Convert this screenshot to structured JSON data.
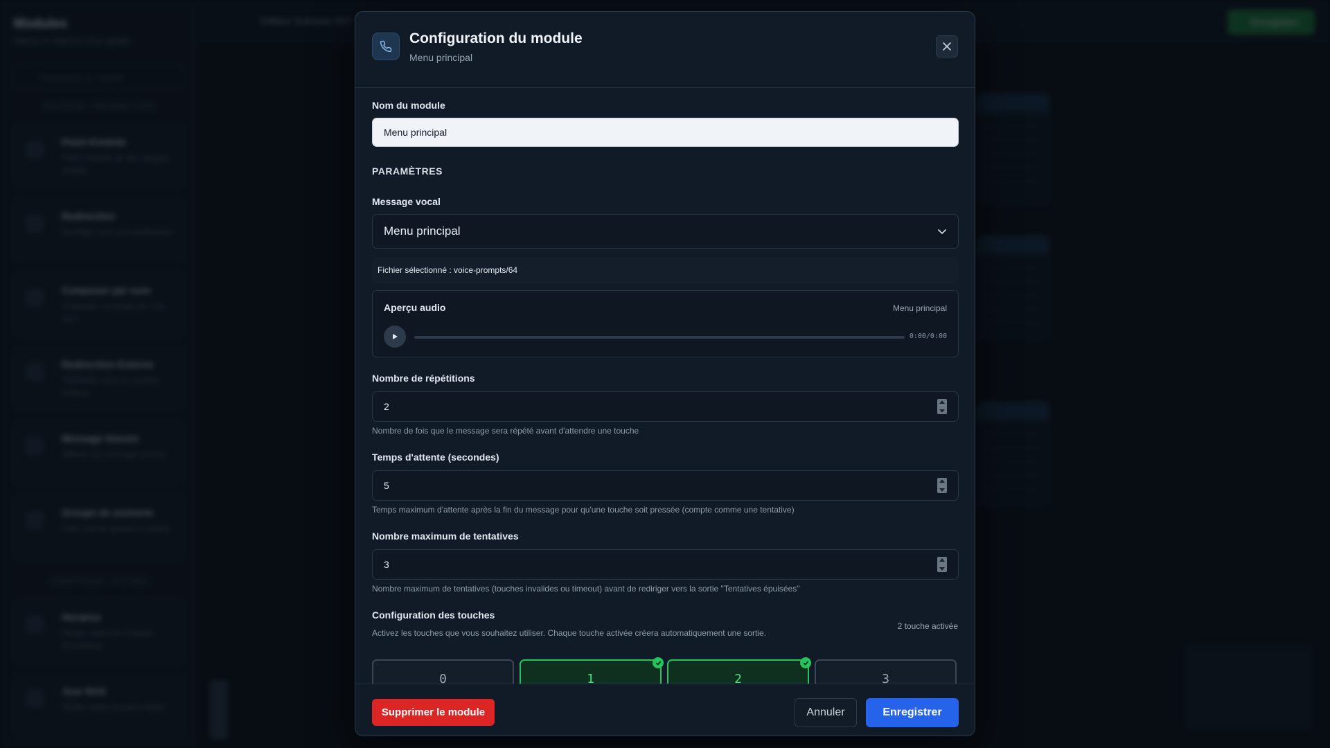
{
  "background": {
    "sidebar_title": "Modules",
    "sidebar_subtitle": "Glissez et déposez pour ajouter",
    "search_placeholder": "Rechercher un module",
    "section_routing": "ROUTAGE / REDIRECTION",
    "section_conditions": "CONDITIONS / FILTRES",
    "cards": [
      {
        "name": "Point d'entrée",
        "desc": "Point d'entrée du flux d'appel entrant"
      },
      {
        "name": "Redirection",
        "desc": "Rediriger vers une destination"
      },
      {
        "name": "Composer par nom",
        "desc": "Composer un poste par son nom"
      },
      {
        "name": "Redirection Externe",
        "desc": "Transférer vers un numéro externe"
      },
      {
        "name": "Message Sonore",
        "desc": "Diffuser un message sonore"
      },
      {
        "name": "Groupe de sonnerie",
        "desc": "Faire sonner plusieurs postes"
      },
      {
        "name": "Horaires",
        "desc": "Router selon les horaires d'ouverture"
      },
      {
        "name": "Jour férié",
        "desc": "Router selon les jours fériés"
      }
    ],
    "topbar_title": "Éditeur Scénario SVI",
    "topbar_save": "Enregistrer"
  },
  "modal": {
    "title": "Configuration du module",
    "subtitle": "Menu principal",
    "name_label": "Nom du module",
    "name_value": "Menu principal",
    "params_title": "PARAMÈTRES",
    "voice_label": "Message vocal",
    "voice_value": "Menu principal",
    "selected_file": "Fichier sélectionné : voice-prompts/64",
    "audio": {
      "title": "Aperçu audio",
      "name": "Menu principal",
      "time": "0:00/0:00",
      "progress": 0
    },
    "repetitions": {
      "label": "Nombre de répétitions",
      "value": "2",
      "help": "Nombre de fois que le message sera répété avant d'attendre une touche"
    },
    "timeout": {
      "label": "Temps d'attente (secondes)",
      "value": "5",
      "help": "Temps maximum d'attente après la fin du message pour qu'une touche soit pressée (compte comme une tentative)"
    },
    "max_attempts": {
      "label": "Nombre maximum de tentatives",
      "value": "3",
      "help": "Nombre maximum de tentatives (touches invalides ou timeout) avant de rediriger vers la sortie \"Tentatives épuisées\""
    },
    "keys": {
      "label": "Configuration des touches",
      "count": "2 touche activée",
      "help": "Activez les touches que vous souhaitez utiliser. Chaque touche activée créera automatiquement une sortie.",
      "items": [
        {
          "key": "0",
          "active": false
        },
        {
          "key": "1",
          "active": true
        },
        {
          "key": "2",
          "active": true
        },
        {
          "key": "3",
          "active": false
        }
      ]
    },
    "footer": {
      "delete": "Supprimer le module",
      "cancel": "Annuler",
      "save": "Enregistrer"
    }
  },
  "colors": {
    "accent": "#2563eb",
    "danger": "#dc2626",
    "success": "#22c55e"
  }
}
